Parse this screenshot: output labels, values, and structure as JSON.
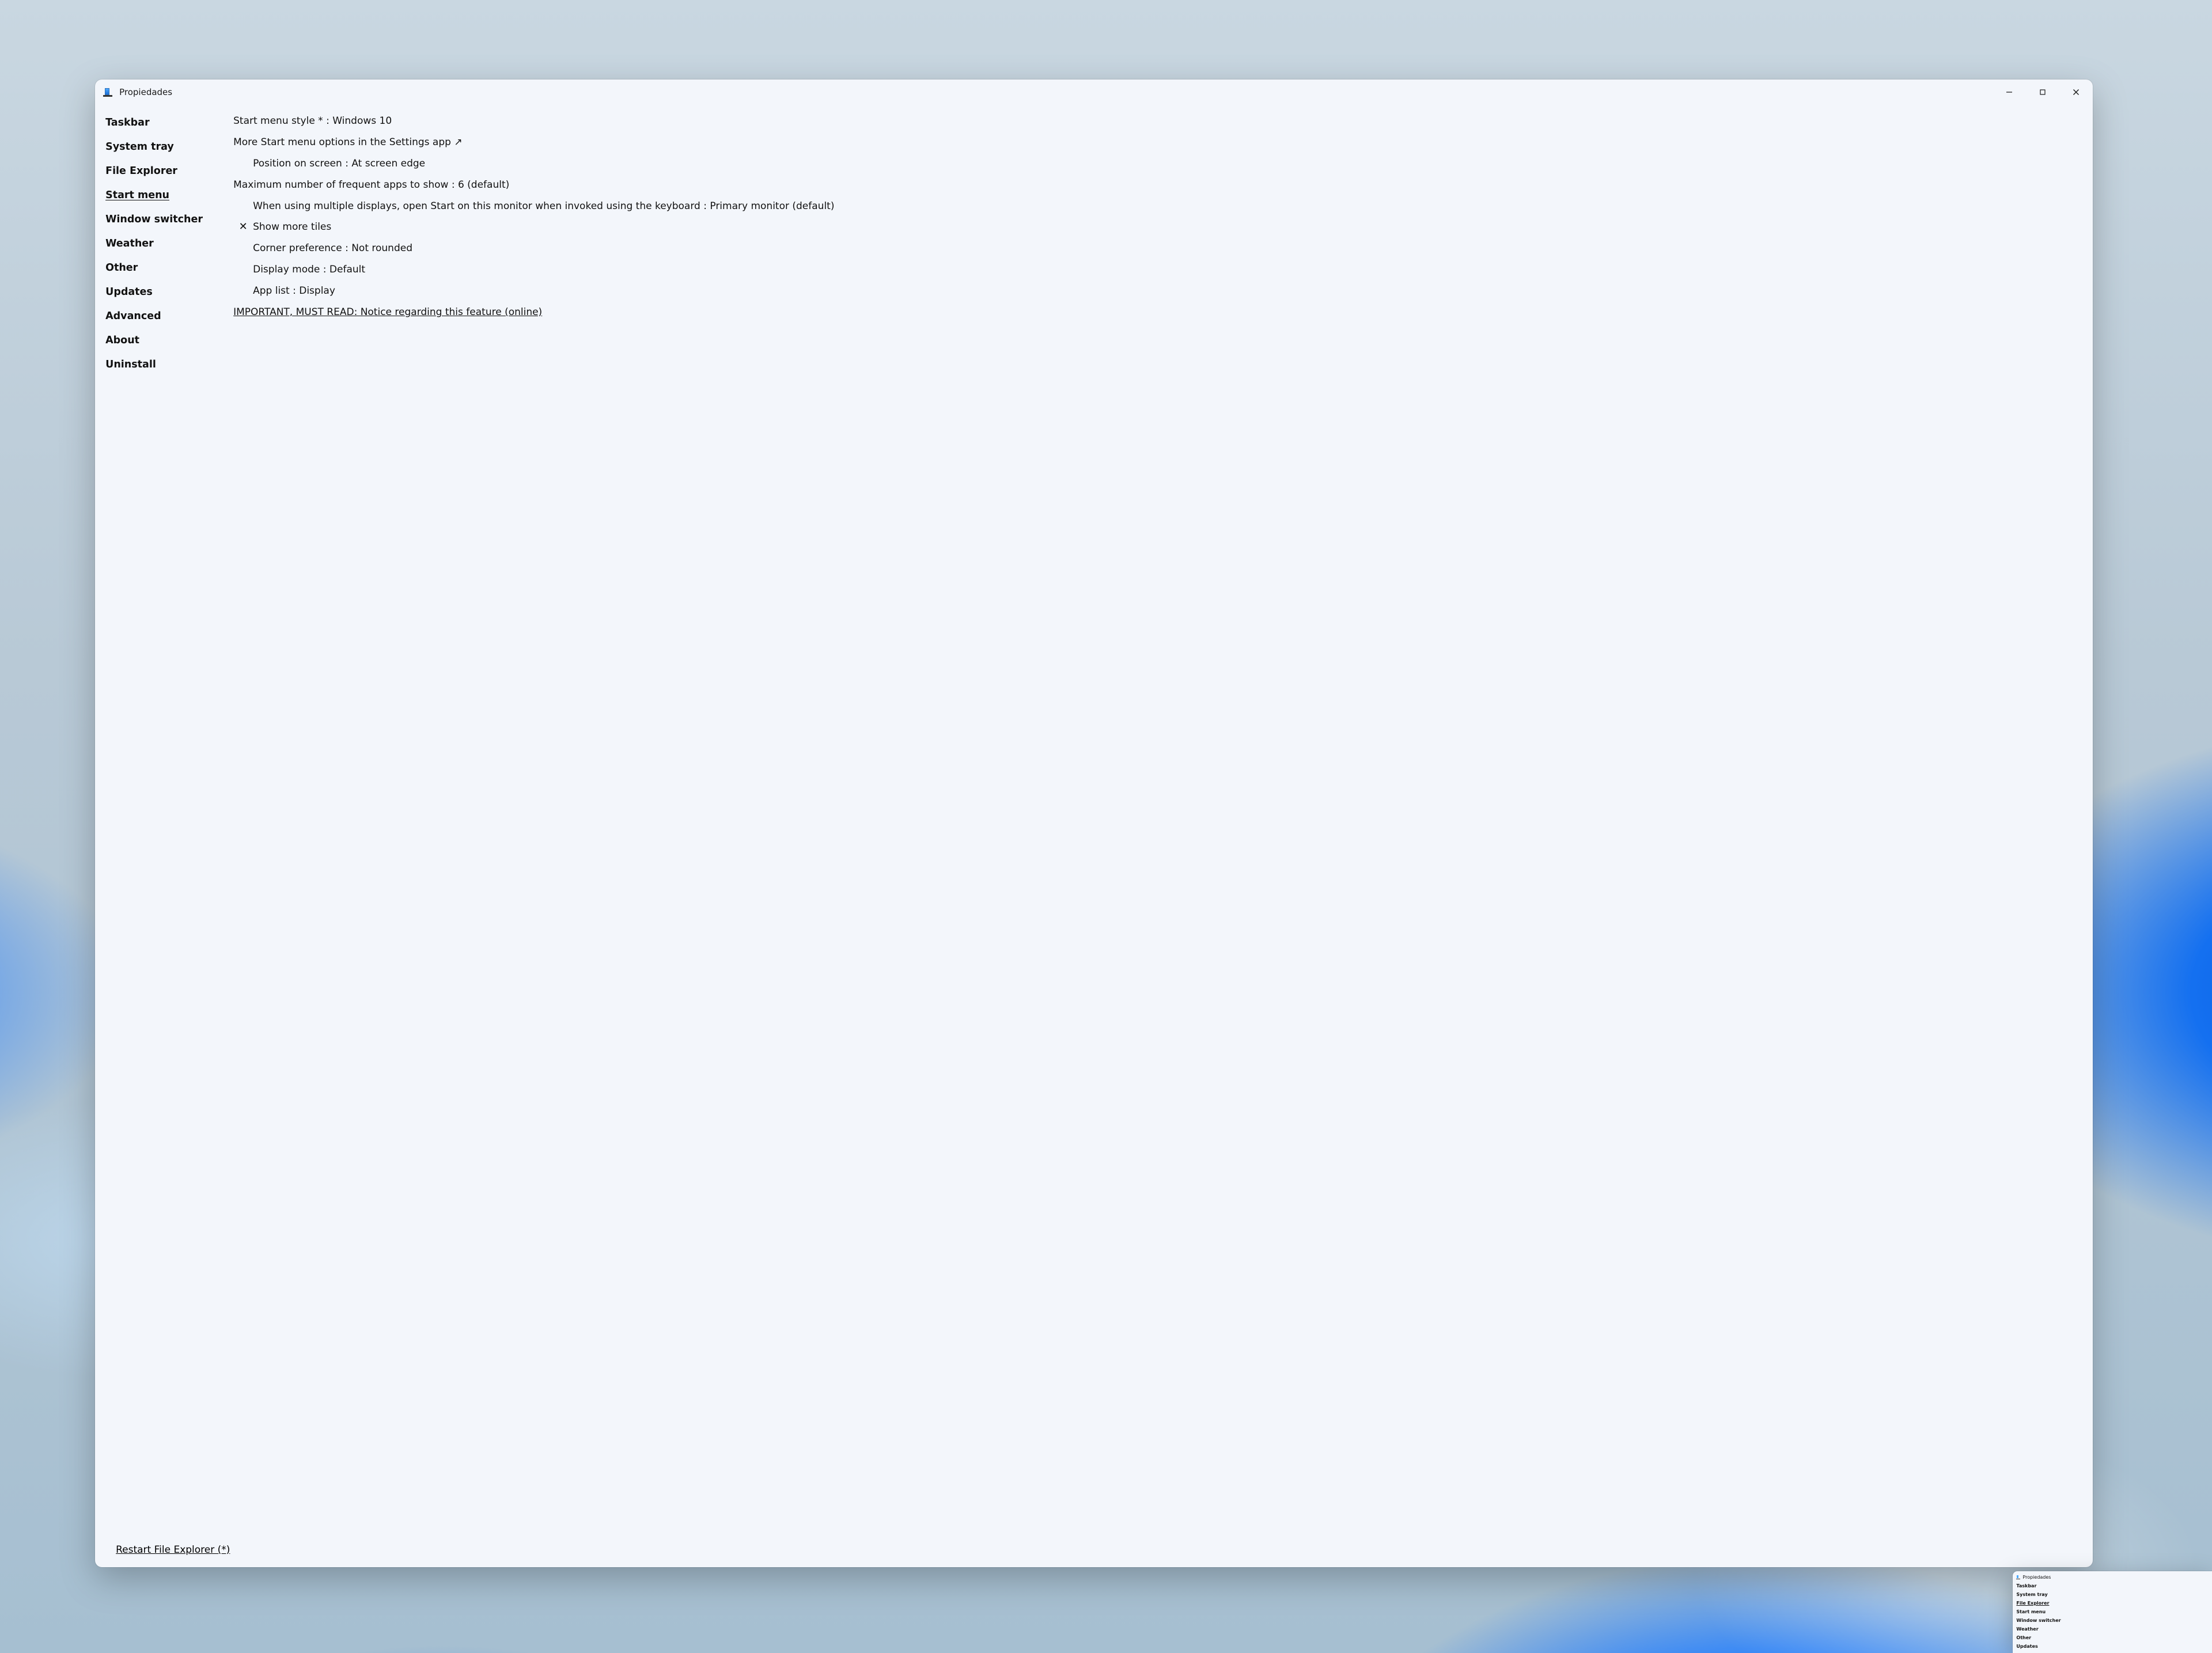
{
  "window": {
    "title": "Propiedades"
  },
  "sidebar": {
    "items": [
      {
        "id": "taskbar",
        "label": "Taskbar",
        "active": false
      },
      {
        "id": "system-tray",
        "label": "System tray",
        "active": false
      },
      {
        "id": "file-explorer",
        "label": "File Explorer",
        "active": false
      },
      {
        "id": "start-menu",
        "label": "Start menu",
        "active": true
      },
      {
        "id": "window-switcher",
        "label": "Window switcher",
        "active": false
      },
      {
        "id": "weather",
        "label": "Weather",
        "active": false
      },
      {
        "id": "other",
        "label": "Other",
        "active": false
      },
      {
        "id": "updates",
        "label": "Updates",
        "active": false
      },
      {
        "id": "advanced",
        "label": "Advanced",
        "active": false
      },
      {
        "id": "about",
        "label": "About",
        "active": false
      },
      {
        "id": "uninstall",
        "label": "Uninstall",
        "active": false
      }
    ]
  },
  "content": {
    "start_style": "Start menu style * : Windows 10",
    "more_options": "More Start menu options in the Settings app",
    "position": "Position on screen : At screen edge",
    "max_apps": "Maximum number of frequent apps to show : 6 (default)",
    "multi_display": "When using multiple displays, open Start on this monitor when invoked using the keyboard : Primary monitor (default)",
    "show_tiles": "Show more tiles",
    "corner": "Corner preference : Not rounded",
    "display_mode": "Display mode : Default",
    "app_list": "App list : Display",
    "notice": "IMPORTANT, MUST READ: Notice regarding this feature (online)"
  },
  "footer": {
    "restart": "Restart File Explorer (*)"
  },
  "preview": {
    "title": "Propiedades",
    "items": [
      {
        "label": "Taskbar",
        "u": false
      },
      {
        "label": "System tray",
        "u": false
      },
      {
        "label": "File Explorer",
        "u": true
      },
      {
        "label": "Start menu",
        "u": false
      },
      {
        "label": "Window switcher",
        "u": false
      },
      {
        "label": "Weather",
        "u": false
      },
      {
        "label": "Other",
        "u": false
      },
      {
        "label": "Updates",
        "u": false
      }
    ]
  }
}
